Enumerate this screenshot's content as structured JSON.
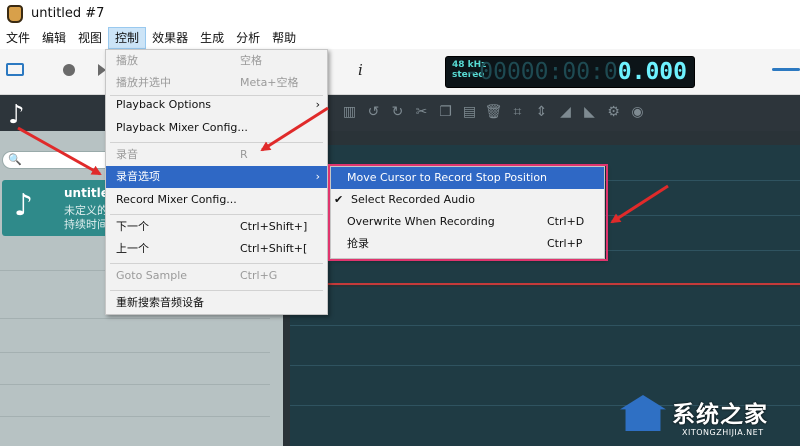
{
  "window": {
    "title": "untitled #7"
  },
  "menubar": {
    "items": [
      "文件",
      "编辑",
      "视图",
      "控制",
      "效果器",
      "生成",
      "分析",
      "帮助"
    ]
  },
  "toolbar": {
    "sample_rate": "48 kHz",
    "channels": "stereo",
    "time_dim": "-00000:00:0",
    "time_bright": "0.000",
    "info_icon": "i"
  },
  "sidebar": {
    "search_icon": "🔍",
    "file": {
      "name": "untitled",
      "line1": "未定义的",
      "line2": "持续时间"
    }
  },
  "control_menu": {
    "items": [
      {
        "label": "播放",
        "shortcut": "空格",
        "disabled": true
      },
      {
        "label": "播放并选中",
        "shortcut": "Meta+空格",
        "disabled": true
      },
      {
        "label": "Playback Options",
        "arrow": "›"
      },
      {
        "label": "Playback Mixer Config..."
      },
      {
        "label": "录音",
        "shortcut": "R",
        "disabled": true
      },
      {
        "label": "录音选项",
        "arrow": "›",
        "selected": true
      },
      {
        "label": "Record Mixer Config..."
      },
      {
        "label": "下一个",
        "shortcut": "Ctrl+Shift+]"
      },
      {
        "label": "上一个",
        "shortcut": "Ctrl+Shift+["
      },
      {
        "label": "Goto Sample",
        "shortcut": "Ctrl+G",
        "disabled": true
      },
      {
        "label": "重新搜索音频设备"
      }
    ]
  },
  "record_options_submenu": {
    "items": [
      {
        "label": "Move Cursor to Record Stop Position",
        "selected": true
      },
      {
        "label": "Select Recorded Audio",
        "checked": true,
        "check": "✔"
      },
      {
        "label": "Overwrite When Recording",
        "shortcut": "Ctrl+D"
      },
      {
        "label": "抢录",
        "shortcut": "Ctrl+P"
      }
    ]
  },
  "watermark": {
    "name": "系统之家",
    "url": "XITONGZHIJIA.NET"
  },
  "colors": {
    "accent": "#2f68c5",
    "highlight_box": "#e0356e",
    "arrow": "#e02a2a"
  }
}
